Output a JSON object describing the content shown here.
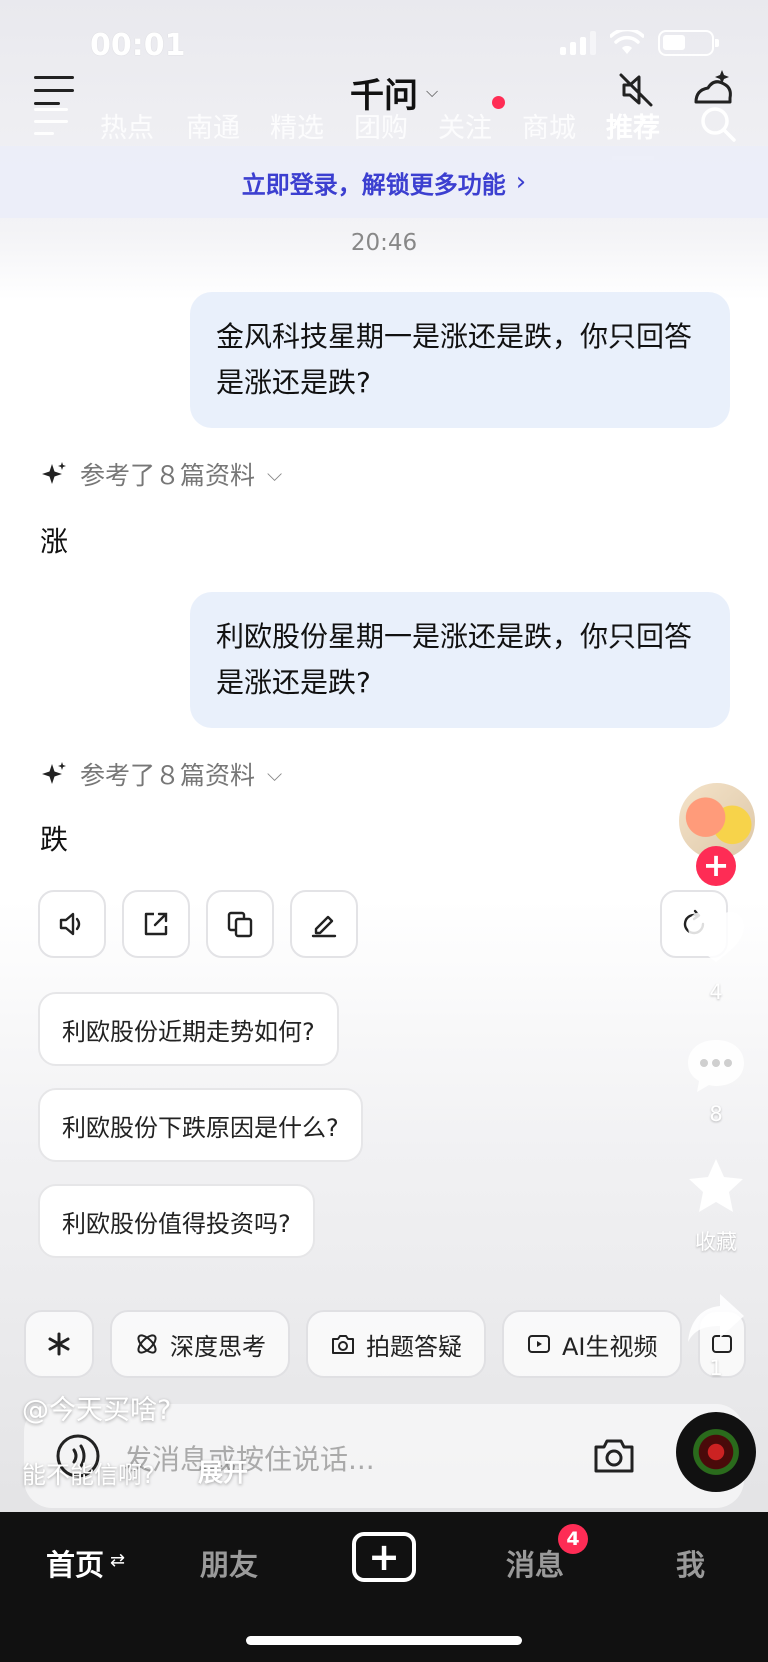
{
  "status_bar": {
    "time": "00:01"
  },
  "header": {
    "title": "千问",
    "tabs": [
      {
        "label": "热点"
      },
      {
        "label": "南通"
      },
      {
        "label": "精选"
      },
      {
        "label": "团购"
      },
      {
        "label": "关注"
      },
      {
        "label": "商城"
      },
      {
        "label": "推荐",
        "active": true
      }
    ]
  },
  "login_banner": {
    "text": "立即登录，解锁更多功能"
  },
  "chat": {
    "timestamp": "20:46",
    "messages": [
      {
        "question": "金风科技星期一是涨还是跌，你只回答是涨还是跌?",
        "refs": "参考了８篇资料",
        "answer": "涨"
      },
      {
        "question": "利欧股份星期一是涨还是跌，你只回答是涨还是跌?",
        "refs": "参考了８篇资料",
        "answer": "跌"
      }
    ],
    "actions": [
      {
        "icon": "speaker-icon"
      },
      {
        "icon": "share-icon"
      },
      {
        "icon": "copy-icon"
      },
      {
        "icon": "edit-icon"
      },
      {
        "icon": "refresh-icon"
      }
    ],
    "suggestions": [
      "利欧股份近期走势如何?",
      "利欧股份下跌原因是什么?",
      "利欧股份值得投资吗?"
    ]
  },
  "toolbar": {
    "chips": [
      {
        "label": "深度思考"
      },
      {
        "label": "拍题答疑"
      },
      {
        "label": "AI生视频"
      }
    ]
  },
  "input": {
    "placeholder": "发消息或按住说话..."
  },
  "overlay": {
    "username": "@今天买啥?",
    "caption": "能不能信啊?",
    "expand": "展开"
  },
  "side_rail": {
    "like_count": "4",
    "comment_count": "8",
    "favorite_label": "收藏",
    "share_count": "1"
  },
  "bottom_nav": {
    "home": "首页",
    "friends": "朋友",
    "messages": "消息",
    "messages_badge": "4",
    "me": "我"
  },
  "colors": {
    "accent": "#3c3fd0",
    "badge": "#fe2c55",
    "bubble": "#e9f0fb",
    "nav_bg": "#111111"
  }
}
